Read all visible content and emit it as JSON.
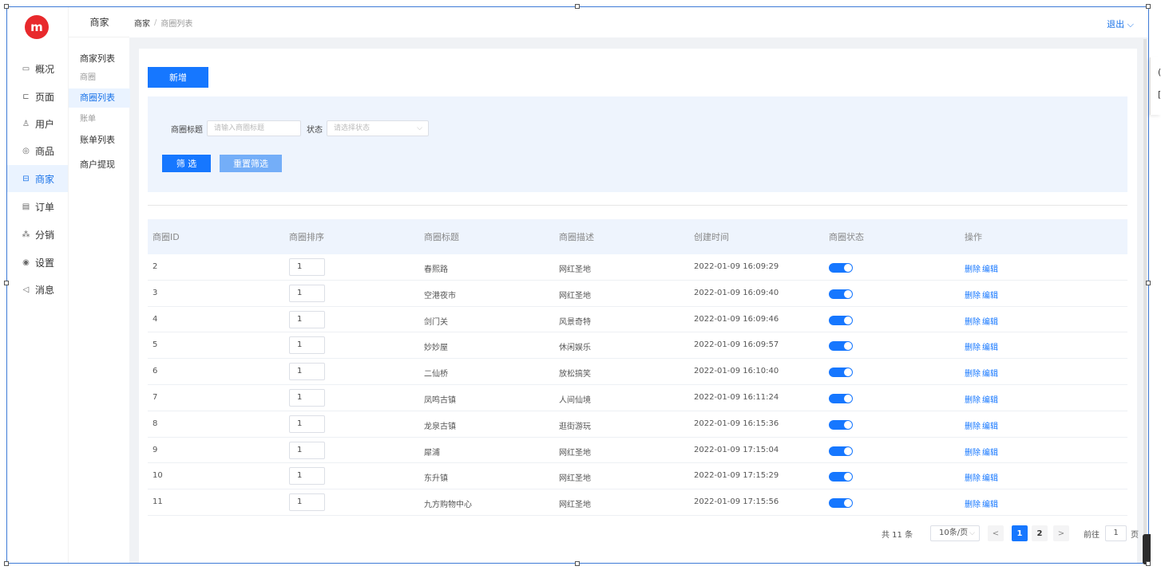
{
  "sidebar": {
    "logo": "m",
    "items": [
      {
        "label": "概况",
        "icon": "dashboard-icon",
        "glyph": "▭"
      },
      {
        "label": "页面",
        "icon": "page-icon",
        "glyph": "⊏"
      },
      {
        "label": "用户",
        "icon": "user-icon",
        "glyph": "♙"
      },
      {
        "label": "商品",
        "icon": "goods-icon",
        "glyph": "◎"
      },
      {
        "label": "商家",
        "icon": "merchant-icon",
        "glyph": "⊟"
      },
      {
        "label": "订单",
        "icon": "order-icon",
        "glyph": "▤"
      },
      {
        "label": "分销",
        "icon": "distribution-icon",
        "glyph": "⁂"
      },
      {
        "label": "设置",
        "icon": "settings-icon",
        "glyph": "◉"
      },
      {
        "label": "消息",
        "icon": "message-icon",
        "glyph": "◁"
      }
    ],
    "active_index": 4
  },
  "subbar": {
    "title": "商家",
    "items": [
      {
        "label": "商家列表",
        "type": "item"
      },
      {
        "label": "商圈",
        "type": "group"
      },
      {
        "label": "商圈列表",
        "type": "item",
        "active": true
      },
      {
        "label": "账单",
        "type": "group"
      },
      {
        "label": "账单列表",
        "type": "item"
      },
      {
        "label": "商户提现",
        "type": "item"
      }
    ]
  },
  "header": {
    "breadcrumb": [
      "商家",
      "商圈列表"
    ],
    "breadcrumb_sep": "/",
    "logout": "退出",
    "logout_chevron": "⌵"
  },
  "toolbar": {
    "add_label": "新增"
  },
  "filter": {
    "title_label": "商圈标题",
    "title_placeholder": "请输入商圈标题",
    "status_label": "状态",
    "status_placeholder": "请选择状态",
    "filter_button": "筛 选",
    "reset_button": "重置筛选"
  },
  "table": {
    "columns": [
      "商圈ID",
      "商圈排序",
      "商圈标题",
      "商圈描述",
      "创建时间",
      "商圈状态",
      "操作"
    ],
    "delete_label": "删除",
    "edit_label": "编辑",
    "rows": [
      {
        "id": "2",
        "sort": "1",
        "title": "春熙路",
        "desc": "网红圣地",
        "created": "2022-01-09 16:09:29",
        "enabled": true
      },
      {
        "id": "3",
        "sort": "1",
        "title": "空港夜市",
        "desc": "网红圣地",
        "created": "2022-01-09 16:09:40",
        "enabled": true
      },
      {
        "id": "4",
        "sort": "1",
        "title": "剑门关",
        "desc": "风景奇特",
        "created": "2022-01-09 16:09:46",
        "enabled": true
      },
      {
        "id": "5",
        "sort": "1",
        "title": "妙妙屋",
        "desc": "休闲娱乐",
        "created": "2022-01-09 16:09:57",
        "enabled": true
      },
      {
        "id": "6",
        "sort": "1",
        "title": "二仙桥",
        "desc": "放松搞笑",
        "created": "2022-01-09 16:10:40",
        "enabled": true
      },
      {
        "id": "7",
        "sort": "1",
        "title": "凤鸣古镇",
        "desc": "人间仙境",
        "created": "2022-01-09 16:11:24",
        "enabled": true
      },
      {
        "id": "8",
        "sort": "1",
        "title": "龙泉古镇",
        "desc": "逛街游玩",
        "created": "2022-01-09 16:15:36",
        "enabled": true
      },
      {
        "id": "9",
        "sort": "1",
        "title": "犀浦",
        "desc": "网红圣地",
        "created": "2022-01-09 17:15:04",
        "enabled": true
      },
      {
        "id": "10",
        "sort": "1",
        "title": "东升镇",
        "desc": "网红圣地",
        "created": "2022-01-09 17:15:29",
        "enabled": true
      },
      {
        "id": "11",
        "sort": "1",
        "title": "九方购物中心",
        "desc": "网红圣地",
        "created": "2022-01-09 17:15:56",
        "enabled": true
      }
    ]
  },
  "pagination": {
    "total": "共 11 条",
    "page_size": "10条/页",
    "prev": "<",
    "next": ">",
    "pages": [
      "1",
      "2"
    ],
    "current": "1",
    "goto_label": "前往",
    "goto_value": "1",
    "page_suffix": "页"
  },
  "peek": {
    "lines": [
      "(",
      "["
    ]
  },
  "colors": {
    "accent": "#1677ff",
    "active_bg": "#eaf3ff",
    "logo": "#e8292c"
  }
}
